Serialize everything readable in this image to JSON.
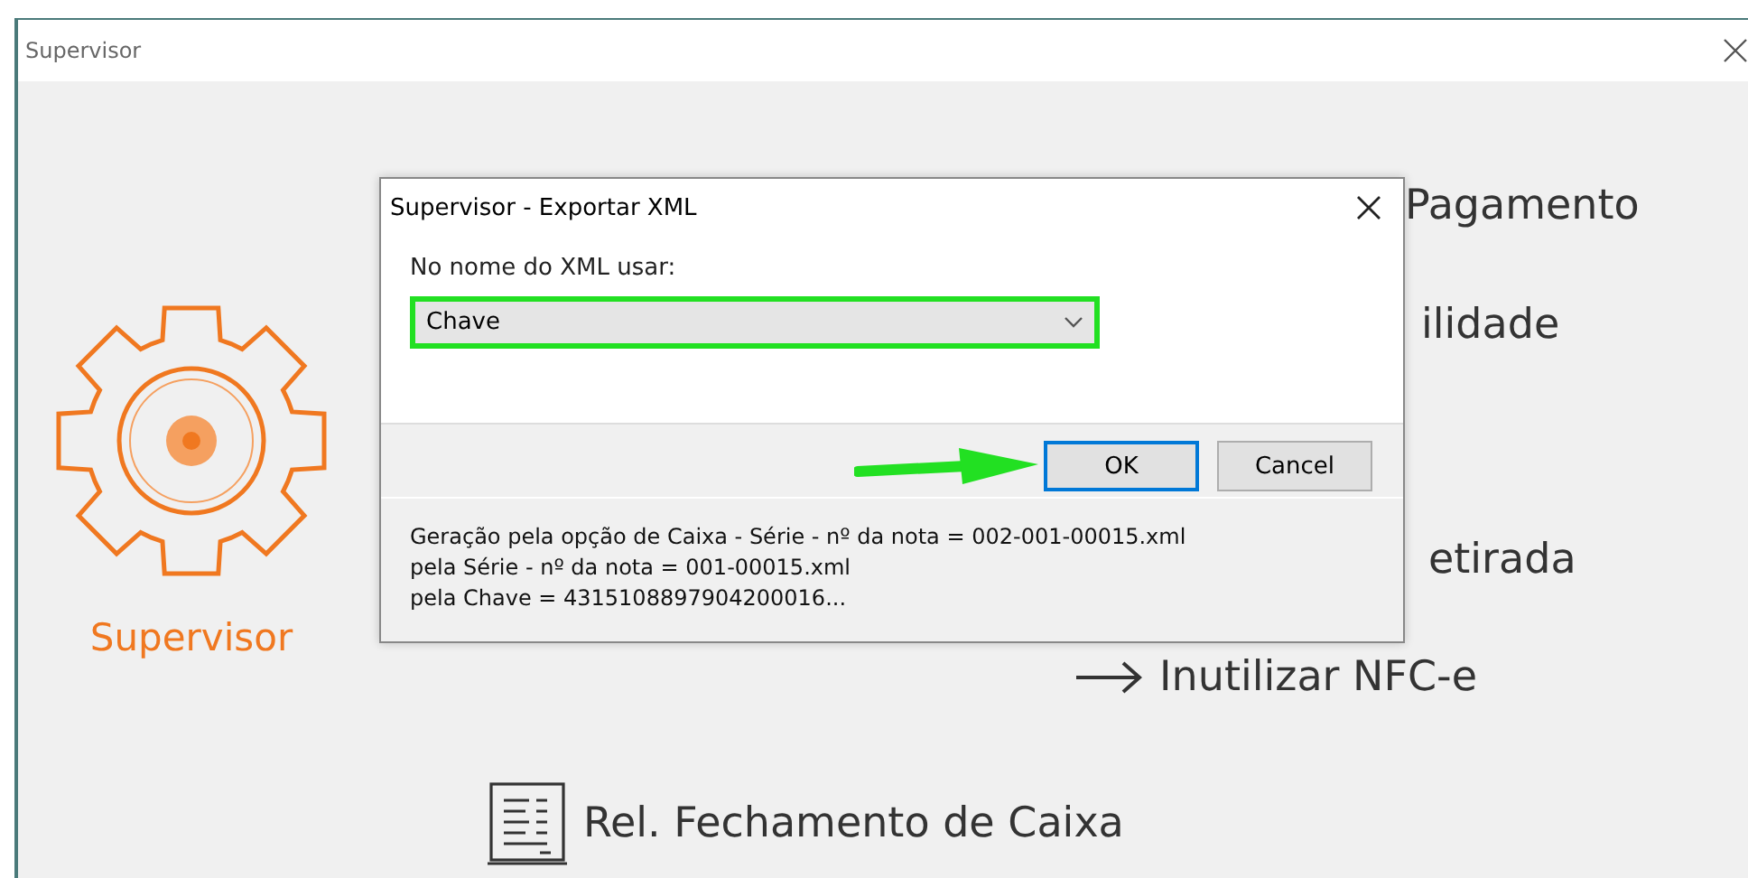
{
  "window": {
    "title": "Supervisor"
  },
  "sidebar": {
    "label": "Supervisor"
  },
  "menu_items": [
    {
      "label": "Pagamento",
      "kind": "text"
    },
    {
      "label": "ilidade",
      "kind": "text"
    },
    {
      "label": "etirada",
      "kind": "text"
    },
    {
      "label": "Inutilizar NFC-e",
      "kind": "arrow"
    },
    {
      "label": "Rel. Fechamento de Caixa",
      "kind": "receipt"
    }
  ],
  "dialog": {
    "title": "Supervisor - Exportar XML",
    "field_label": "No nome do XML usar:",
    "select": {
      "value": "Chave",
      "highlighted": true
    },
    "buttons": [
      {
        "label": "OK",
        "selected": true
      },
      {
        "label": "Cancel",
        "selected": false
      }
    ],
    "info_lines": [
      "Geração pela opção de Caixa - Série - nº da nota = 002-001-00015.xml",
      "pela Série - nº da nota = 001-00015.xml",
      "pela Chave = 4315108897904200016..."
    ]
  }
}
